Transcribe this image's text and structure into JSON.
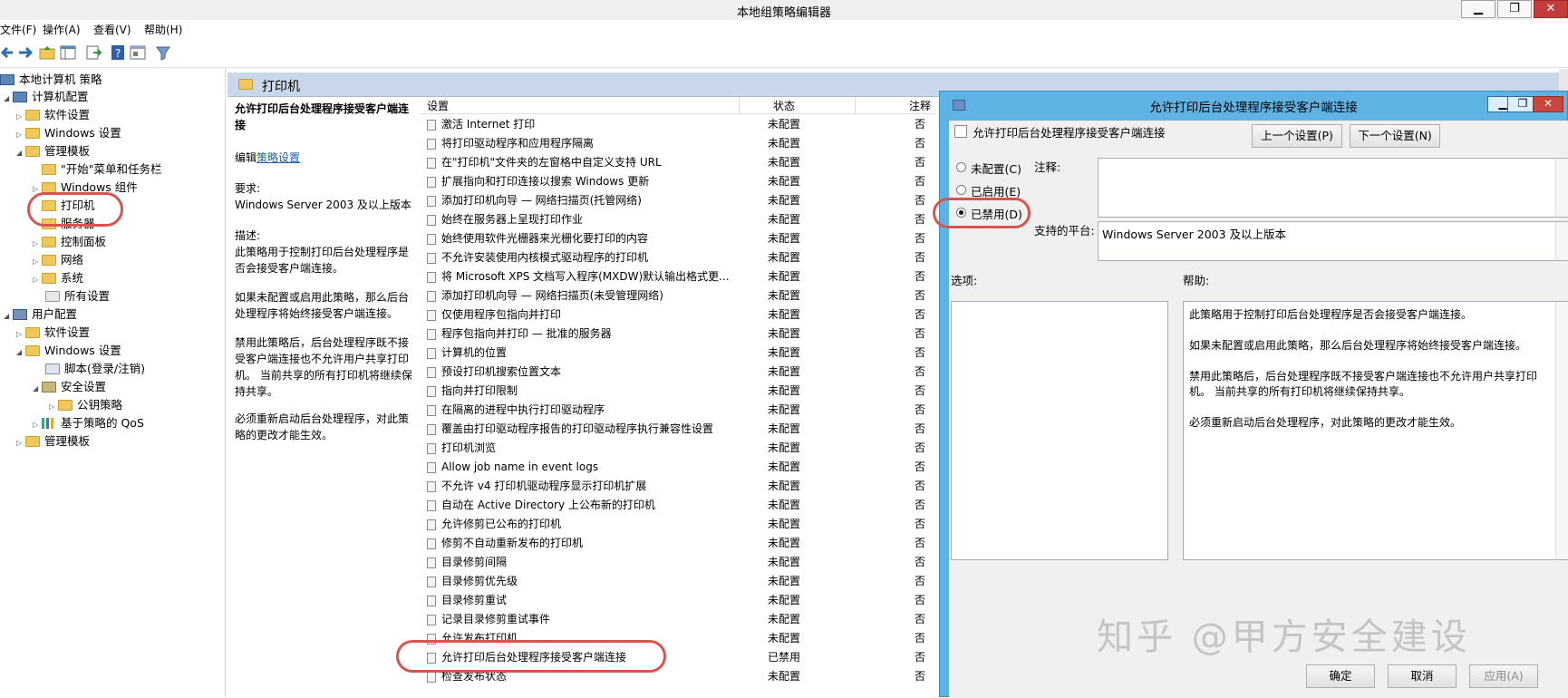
{
  "window": {
    "title": "本地组策略编辑器",
    "min_label": "▁",
    "max_label": "❐",
    "close_label": "✕"
  },
  "menu": {
    "items": [
      "文件(F)",
      "操作(A)",
      "查看(V)",
      "帮助(H)"
    ]
  },
  "toolbar": {
    "icons": [
      "back-arrow-icon",
      "forward-arrow-icon",
      "up-folder-icon",
      "show-hide-tree-icon",
      "export-list-icon",
      "help-icon",
      "properties-icon",
      "filter-icon"
    ]
  },
  "tree": {
    "items": [
      {
        "label": "本地计算机 策略",
        "icon": "computer-policy-icon"
      },
      {
        "label": "计算机配置",
        "icon": "computer-icon",
        "expander": "◢"
      },
      {
        "label": "软件设置",
        "icon": "folder-icon",
        "expander": "▷"
      },
      {
        "label": "Windows 设置",
        "icon": "folder-icon",
        "expander": "▷"
      },
      {
        "label": "管理模板",
        "icon": "folder-icon",
        "expander": "◢"
      },
      {
        "label": "\"开始\"菜单和任务栏",
        "icon": "folder-icon"
      },
      {
        "label": "Windows 组件",
        "icon": "folder-icon",
        "expander": "▷"
      },
      {
        "label": "打印机",
        "icon": "folder-icon"
      },
      {
        "label": "服务器",
        "icon": "folder-icon"
      },
      {
        "label": "控制面板",
        "icon": "folder-icon",
        "expander": "▷"
      },
      {
        "label": "网络",
        "icon": "folder-icon",
        "expander": "▷"
      },
      {
        "label": "系统",
        "icon": "folder-icon",
        "expander": "▷"
      },
      {
        "label": "所有设置",
        "icon": "all-settings-icon"
      },
      {
        "label": "用户配置",
        "icon": "user-icon",
        "expander": "◢"
      },
      {
        "label": "软件设置",
        "icon": "folder-icon",
        "expander": "▷"
      },
      {
        "label": "Windows 设置",
        "icon": "folder-icon",
        "expander": "◢"
      },
      {
        "label": "脚本(登录/注销)",
        "icon": "script-icon"
      },
      {
        "label": "安全设置",
        "icon": "security-icon",
        "expander": "◢"
      },
      {
        "label": "公钥策略",
        "icon": "folder-icon",
        "expander": "▷"
      },
      {
        "label": "基于策略的 QoS",
        "icon": "qos-chart-icon",
        "expander": "▷"
      },
      {
        "label": "管理模板",
        "icon": "folder-icon",
        "expander": "▷"
      }
    ]
  },
  "header": {
    "folder_title": "打印机"
  },
  "description": {
    "policy_title": "允许打印后台处理程序接受客户端连接",
    "edit_prefix": "编辑",
    "edit_link": "策略设置",
    "requirements_label": "要求:",
    "requirements_value": "Windows Server 2003 及以上版本",
    "description_label": "描述:",
    "paragraph1": "此策略用于控制打印后台处理程序是否会接受客户端连接。",
    "paragraph2": "如果未配置或启用此策略，那么后台处理程序将始终接受客户端连接。",
    "paragraph3": "禁用此策略后，后台处理程序既不接受客户端连接也不允许用户共享打印机。 当前共享的所有打印机将继续保持共享。",
    "paragraph4": "必须重新启动后台处理程序，对此策略的更改才能生效。"
  },
  "settings_list": {
    "columns": {
      "setting": "设置",
      "state": "状态",
      "comment": "注释"
    },
    "rows": [
      {
        "name": "激活 Internet 打印",
        "state": "未配置",
        "comment": "否"
      },
      {
        "name": "将打印驱动程序和应用程序隔离",
        "state": "未配置",
        "comment": "否"
      },
      {
        "name": "在\"打印机\"文件夹的左窗格中自定义支持 URL",
        "state": "未配置",
        "comment": "否"
      },
      {
        "name": "扩展指向和打印连接以搜索 Windows 更新",
        "state": "未配置",
        "comment": "否"
      },
      {
        "name": "添加打印机向导 — 网络扫描页(托管网络)",
        "state": "未配置",
        "comment": "否"
      },
      {
        "name": "始终在服务器上呈现打印作业",
        "state": "未配置",
        "comment": "否"
      },
      {
        "name": "始终使用软件光栅器来光栅化要打印的内容",
        "state": "未配置",
        "comment": "否"
      },
      {
        "name": "不允许安装使用内核模式驱动程序的打印机",
        "state": "未配置",
        "comment": "否"
      },
      {
        "name": "将 Microsoft XPS 文档写入程序(MXDW)默认输出格式更...",
        "state": "未配置",
        "comment": "否"
      },
      {
        "name": "添加打印机向导 — 网络扫描页(未受管理网络)",
        "state": "未配置",
        "comment": "否"
      },
      {
        "name": "仅使用程序包指向并打印",
        "state": "未配置",
        "comment": "否"
      },
      {
        "name": "程序包指向并打印 — 批准的服务器",
        "state": "未配置",
        "comment": "否"
      },
      {
        "name": "计算机的位置",
        "state": "未配置",
        "comment": "否"
      },
      {
        "name": "预设打印机搜索位置文本",
        "state": "未配置",
        "comment": "否"
      },
      {
        "name": "指向并打印限制",
        "state": "未配置",
        "comment": "否"
      },
      {
        "name": "在隔离的进程中执行打印驱动程序",
        "state": "未配置",
        "comment": "否"
      },
      {
        "name": "覆盖由打印驱动程序报告的打印驱动程序执行兼容性设置",
        "state": "未配置",
        "comment": "否"
      },
      {
        "name": "打印机浏览",
        "state": "未配置",
        "comment": "否"
      },
      {
        "name": "Allow job name in event logs",
        "state": "未配置",
        "comment": "否"
      },
      {
        "name": "不允许 v4 打印机驱动程序显示打印机扩展",
        "state": "未配置",
        "comment": "否"
      },
      {
        "name": "自动在 Active Directory 上公布新的打印机",
        "state": "未配置",
        "comment": "否"
      },
      {
        "name": "允许修剪已公布的打印机",
        "state": "未配置",
        "comment": "否"
      },
      {
        "name": "修剪不自动重新发布的打印机",
        "state": "未配置",
        "comment": "否"
      },
      {
        "name": "目录修剪间隔",
        "state": "未配置",
        "comment": "否"
      },
      {
        "name": "目录修剪优先级",
        "state": "未配置",
        "comment": "否"
      },
      {
        "name": "目录修剪重试",
        "state": "未配置",
        "comment": "否"
      },
      {
        "name": "记录目录修剪重试事件",
        "state": "未配置",
        "comment": "否"
      },
      {
        "name": "允许发布打印机",
        "state": "未配置",
        "comment": "否"
      },
      {
        "name": "允许打印后台处理程序接受客户端连接",
        "state": "已禁用",
        "comment": "否"
      },
      {
        "name": "检查发布状态",
        "state": "未配置",
        "comment": "否"
      }
    ]
  },
  "dialog": {
    "title": "允许打印后台处理程序接受客户端连接",
    "setting_name": "允许打印后台处理程序接受客户端连接",
    "prev_button": "上一个设置(P)",
    "next_button": "下一个设置(N)",
    "radio_not_configured": "未配置(C)",
    "radio_enabled": "已启用(E)",
    "radio_disabled": "已禁用(D)",
    "selected_option": "已禁用(D)",
    "comment_label": "注释:",
    "platform_label": "支持的平台:",
    "platform_value": "Windows Server 2003 及以上版本",
    "options_label": "选项:",
    "help_label": "帮助:",
    "help_p1": "此策略用于控制打印后台处理程序是否会接受客户端连接。",
    "help_p2": "如果未配置或启用此策略，那么后台处理程序将始终接受客户端连接。",
    "help_p3": "禁用此策略后，后台处理程序既不接受客户端连接也不允许用户共享打印机。 当前共享的所有打印机将继续保持共享。",
    "help_p4": "必须重新启动后台处理程序，对此策略的更改才能生效。",
    "ok_button": "确定",
    "cancel_button": "取消",
    "apply_button": "应用(A)"
  },
  "watermark": "知乎 @甲方安全建设",
  "colors": {
    "band": "#c8d8ea",
    "dialog_frame": "#5eb3e4",
    "highlight_oval": "#d9544f",
    "link": "#1a5fb4"
  }
}
